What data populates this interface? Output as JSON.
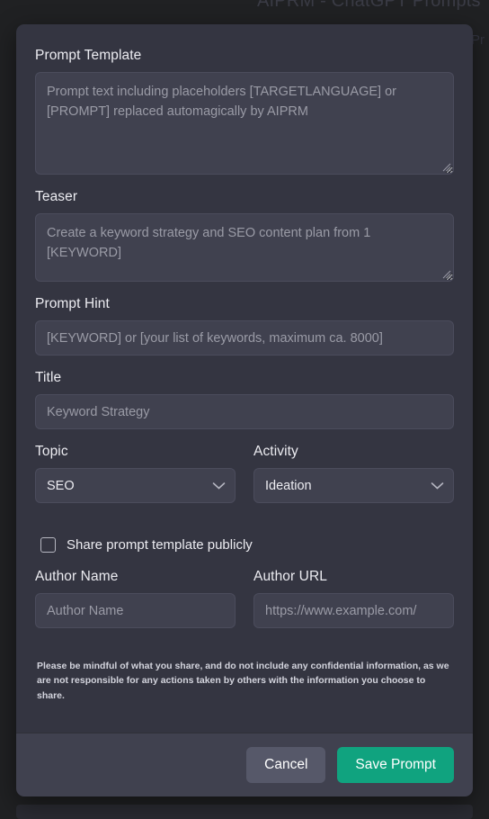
{
  "background": {
    "title": "AIPRM - ChatGPT Prompts",
    "side_label": "Pr",
    "backdrop_color": "#202123"
  },
  "modal": {
    "surface_color": "#343541",
    "footer_color": "#40414f",
    "fields": {
      "prompt_template": {
        "label": "Prompt Template",
        "value": "",
        "placeholder": "Prompt text including placeholders [TARGETLANGUAGE] or [PROMPT] replaced automagically by AIPRM"
      },
      "teaser": {
        "label": "Teaser",
        "value": "",
        "placeholder": "Create a keyword strategy and SEO content plan from 1 [KEYWORD]"
      },
      "prompt_hint": {
        "label": "Prompt Hint",
        "value": "",
        "placeholder": "[KEYWORD] or [your list of keywords, maximum ca. 8000]"
      },
      "title": {
        "label": "Title",
        "value": "",
        "placeholder": "Keyword Strategy"
      },
      "topic": {
        "label": "Topic",
        "value": "SEO",
        "options": [
          "SEO"
        ],
        "icon": "chevron-down-icon"
      },
      "activity": {
        "label": "Activity",
        "value": "Ideation",
        "options": [
          "Ideation"
        ],
        "icon": "chevron-down-icon"
      },
      "share_publicly": {
        "label": "Share prompt template publicly",
        "checked": false
      },
      "author_name": {
        "label": "Author Name",
        "value": "",
        "placeholder": "Author Name"
      },
      "author_url": {
        "label": "Author URL",
        "value": "",
        "placeholder": "https://www.example.com/"
      }
    },
    "disclaimer": "Please be mindful of what you share, and do not include any confidential information, as we are not responsible for any actions taken by others with the information you choose to share.",
    "footer": {
      "cancel_label": "Cancel",
      "cancel_color": "#565869",
      "save_label": "Save Prompt",
      "save_color": "#10a37f"
    }
  }
}
